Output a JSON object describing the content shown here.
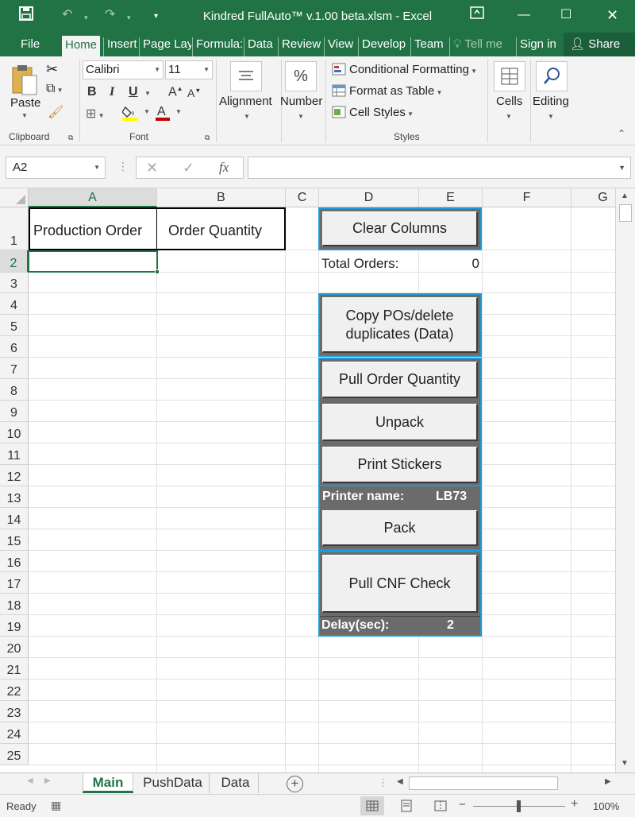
{
  "window": {
    "title": "Kindred FullAuto™ v.1.00 beta.xlsm - Excel"
  },
  "ribbon_tabs": [
    "File",
    "Home",
    "Insert",
    "Page Lay",
    "Formula:",
    "Data",
    "Review",
    "View",
    "Develop",
    "Team"
  ],
  "tell_me": "Tell me",
  "sign_in": "Sign in",
  "share": "Share",
  "clipboard": {
    "paste": "Paste",
    "group": "Clipboard"
  },
  "font": {
    "name": "Calibri",
    "size": "11",
    "group": "Font",
    "bold": "B",
    "italic": "I",
    "underline": "U",
    "grow": "A",
    "shrink": "A",
    "color_letter": "A"
  },
  "alignment": {
    "label": "Alignment"
  },
  "number": {
    "label": "Number"
  },
  "styles": {
    "conditional": "Conditional Formatting",
    "table": "Format as Table",
    "cell_styles": "Cell Styles",
    "group": "Styles"
  },
  "cells": {
    "label": "Cells"
  },
  "editing": {
    "label": "Editing"
  },
  "formula_bar": {
    "name_box": "A2",
    "fx": "fx",
    "value": ""
  },
  "columns": [
    "A",
    "B",
    "C",
    "D",
    "E",
    "F",
    "G"
  ],
  "rows": [
    "1",
    "2",
    "3",
    "4",
    "5",
    "6",
    "7",
    "8",
    "9",
    "10",
    "11",
    "12",
    "13",
    "14",
    "15",
    "16",
    "17",
    "18",
    "19",
    "20",
    "21",
    "22",
    "23",
    "24",
    "25"
  ],
  "cells_data": {
    "a1": "Production Order",
    "b1": "Order Quantity",
    "d2": "Total Orders:",
    "e2": "0"
  },
  "macros": {
    "clear_columns": "Clear Columns",
    "copy_pos_line1": "Copy POs/delete",
    "copy_pos_line2": "duplicates (Data)",
    "pull_order_qty": "Pull Order Quantity",
    "unpack": "Unpack",
    "print_stickers": "Print Stickers",
    "printer_label": "Printer name:",
    "printer_value": "LB73",
    "pack": "Pack",
    "pull_cnf": "Pull CNF Check",
    "delay_label": "Delay(sec):",
    "delay_value": "2"
  },
  "sheets": [
    "Main",
    "PushData",
    "Data"
  ],
  "status": {
    "ready": "Ready",
    "zoom": "100%"
  },
  "colors": {
    "excel_green": "#217346",
    "panel_gray": "#6b6b6b",
    "panel_border": "#1e9ad6"
  }
}
